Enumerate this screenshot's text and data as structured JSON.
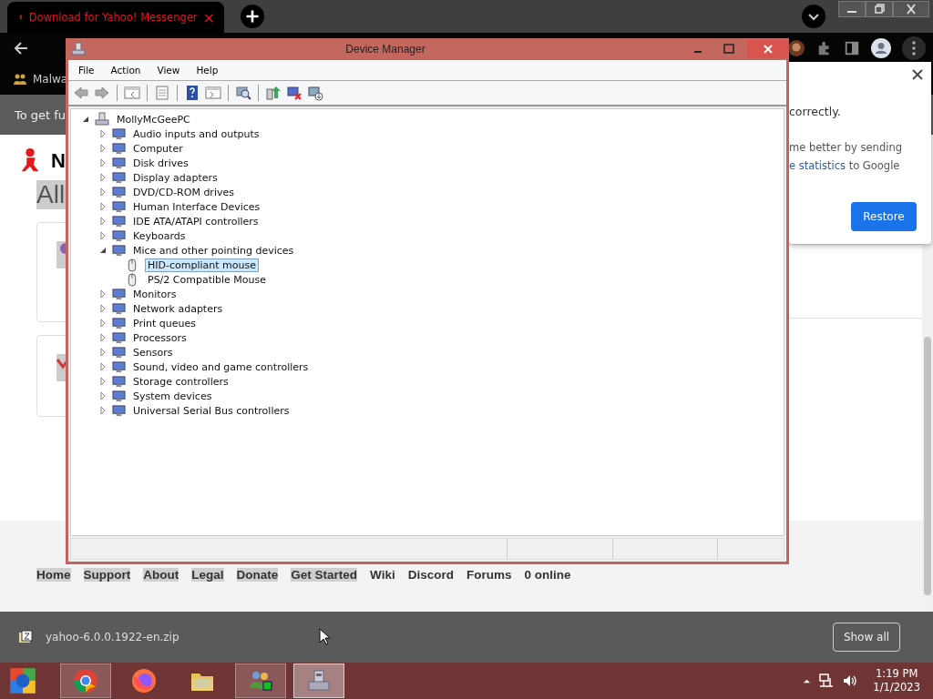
{
  "browser": {
    "tab": {
      "title": "Download for Yahoo! Messenger",
      "close": "×"
    },
    "bookmark": {
      "label": "Malwa"
    },
    "infobar": {
      "text": "To get fu"
    },
    "page": {
      "brand": "N",
      "heading": "All",
      "footer_links": [
        {
          "label": "Home",
          "highlighted": true
        },
        {
          "label": "Support",
          "highlighted": true
        },
        {
          "label": "About",
          "highlighted": true
        },
        {
          "label": "Legal",
          "highlighted": true
        },
        {
          "label": "Donate",
          "highlighted": true
        },
        {
          "label": "Get Started",
          "highlighted": true
        },
        {
          "label": "Wiki",
          "highlighted": false
        },
        {
          "label": "Discord",
          "highlighted": false
        },
        {
          "label": "Forums",
          "highlighted": false
        },
        {
          "label": "0 online",
          "highlighted": false
        }
      ]
    },
    "popup": {
      "line1": "correctly.",
      "line2": "me better by sending",
      "link": "e statistics",
      "line3": "to Google",
      "button": "Restore"
    },
    "downloads": {
      "file": "yahoo-6.0.0.1922-en.zip",
      "show_all": "Show all"
    }
  },
  "device_manager": {
    "title": "Device Manager",
    "menu": [
      "File",
      "Action",
      "View",
      "Help"
    ],
    "tree": {
      "label": "MollyMcGeePC",
      "expanded": true,
      "selected": false,
      "children": [
        {
          "label": "Audio inputs and outputs",
          "expanded": false,
          "selected": false
        },
        {
          "label": "Computer",
          "expanded": false,
          "selected": false
        },
        {
          "label": "Disk drives",
          "expanded": false,
          "selected": false
        },
        {
          "label": "Display adapters",
          "expanded": false,
          "selected": false
        },
        {
          "label": "DVD/CD-ROM drives",
          "expanded": false,
          "selected": false
        },
        {
          "label": "Human Interface Devices",
          "expanded": false,
          "selected": false
        },
        {
          "label": "IDE ATA/ATAPI controllers",
          "expanded": false,
          "selected": false
        },
        {
          "label": "Keyboards",
          "expanded": false,
          "selected": false
        },
        {
          "label": "Mice and other pointing devices",
          "expanded": true,
          "selected": false,
          "children": [
            {
              "label": "HID-compliant mouse",
              "selected": true
            },
            {
              "label": "PS/2 Compatible Mouse",
              "selected": false
            }
          ]
        },
        {
          "label": "Monitors",
          "expanded": false,
          "selected": false
        },
        {
          "label": "Network adapters",
          "expanded": false,
          "selected": false
        },
        {
          "label": "Print queues",
          "expanded": false,
          "selected": false
        },
        {
          "label": "Processors",
          "expanded": false,
          "selected": false
        },
        {
          "label": "Sensors",
          "expanded": false,
          "selected": false
        },
        {
          "label": "Sound, video and game controllers",
          "expanded": false,
          "selected": false
        },
        {
          "label": "Storage controllers",
          "expanded": false,
          "selected": false
        },
        {
          "label": "System devices",
          "expanded": false,
          "selected": false
        },
        {
          "label": "Universal Serial Bus controllers",
          "expanded": false,
          "selected": false
        }
      ]
    }
  },
  "taskbar": {
    "apps": [
      {
        "kind": "chrome",
        "open": true,
        "selected": false
      },
      {
        "kind": "firefox",
        "open": false,
        "selected": false
      },
      {
        "kind": "folder",
        "open": false,
        "selected": false
      },
      {
        "kind": "people",
        "open": true,
        "selected": false
      },
      {
        "kind": "devices",
        "open": true,
        "selected": true
      }
    ],
    "time": "1:19 PM",
    "date": "1/1/2023"
  }
}
